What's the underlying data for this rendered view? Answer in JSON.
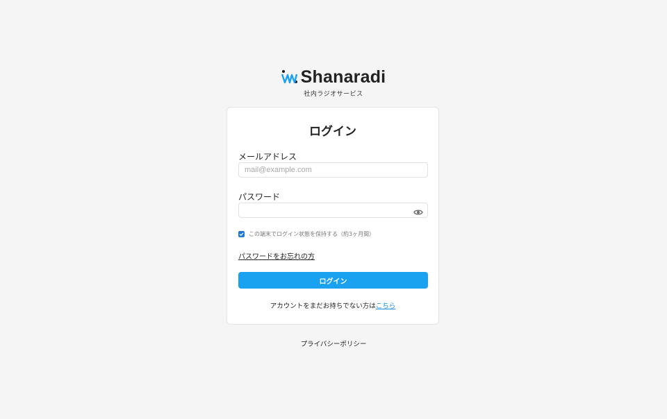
{
  "brand": {
    "logo_icon": "radio-wave-icon",
    "name": "Shanaradi",
    "tagline": "社内ラジオサービス",
    "accent_color": "#1aa1ef"
  },
  "login_card": {
    "title": "ログイン",
    "email": {
      "label": "メールアドレス",
      "value": "",
      "placeholder": "mail@example.com"
    },
    "password": {
      "label": "パスワード",
      "value": "",
      "placeholder": "",
      "toggle_icon": "eye-icon"
    },
    "remember": {
      "checked": true,
      "label": "この端末でログイン状態を保持する（約3ヶ月間）"
    },
    "forgot_link": "パスワードをお忘れの方",
    "submit_label": "ログイン",
    "signup_prompt": "アカウントをまだお持ちでない方は",
    "signup_link": "こちら"
  },
  "footer": {
    "privacy_link": "プライバシーポリシー"
  }
}
